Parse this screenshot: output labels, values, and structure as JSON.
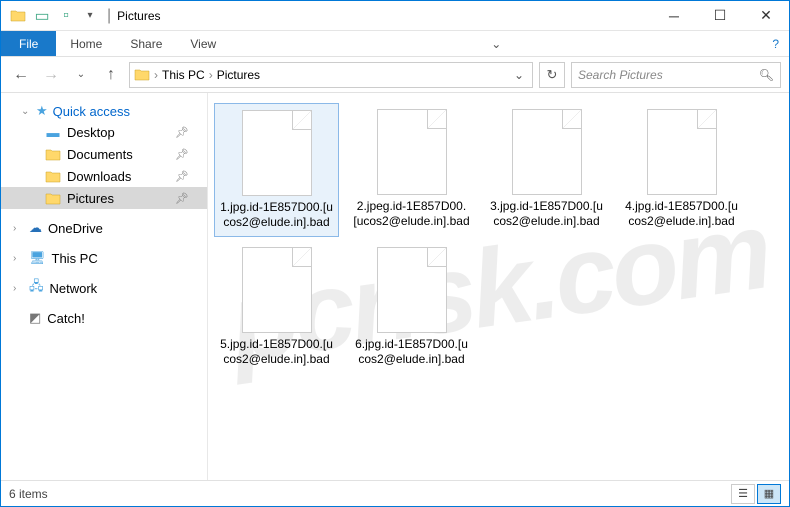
{
  "window": {
    "title": "Pictures"
  },
  "ribbon": {
    "file": "File",
    "home": "Home",
    "share": "Share",
    "view": "View"
  },
  "breadcrumb": {
    "root": "This PC",
    "current": "Pictures"
  },
  "search": {
    "placeholder": "Search Pictures"
  },
  "sidebar": {
    "quick_access": "Quick access",
    "items": [
      {
        "label": "Desktop"
      },
      {
        "label": "Documents"
      },
      {
        "label": "Downloads"
      },
      {
        "label": "Pictures"
      }
    ],
    "onedrive": "OneDrive",
    "thispc": "This PC",
    "network": "Network",
    "catch": "Catch!"
  },
  "files": [
    {
      "name": "1.jpg.id-1E857D00.[ucos2@elude.in].bad"
    },
    {
      "name": "2.jpeg.id-1E857D00.[ucos2@elude.in].bad"
    },
    {
      "name": "3.jpg.id-1E857D00.[ucos2@elude.in].bad"
    },
    {
      "name": "4.jpg.id-1E857D00.[ucos2@elude.in].bad"
    },
    {
      "name": "5.jpg.id-1E857D00.[ucos2@elude.in].bad"
    },
    {
      "name": "6.jpg.id-1E857D00.[ucos2@elude.in].bad"
    }
  ],
  "status": {
    "count": "6 items"
  },
  "watermark": "pcrisk.com"
}
